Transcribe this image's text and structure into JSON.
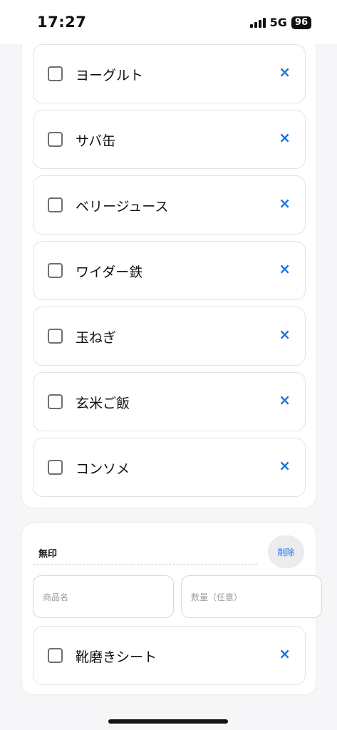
{
  "status": {
    "time": "17:27",
    "network": "5G",
    "battery": "96"
  },
  "list_items": [
    {
      "label": "ヨーグルト",
      "delete_symbol": "×"
    },
    {
      "label": "サバ缶",
      "delete_symbol": "×"
    },
    {
      "label": "ベリージュース",
      "delete_symbol": "×"
    },
    {
      "label": "ワイダー鉄",
      "delete_symbol": "×"
    },
    {
      "label": "玉ねぎ",
      "delete_symbol": "×"
    },
    {
      "label": "玄米ご飯",
      "delete_symbol": "×"
    },
    {
      "label": "コンソメ",
      "delete_symbol": "×"
    }
  ],
  "store": {
    "name": "無印",
    "delete_label": "削除",
    "item_name_placeholder": "商品名",
    "quantity_placeholder": "数量（任意）",
    "items": [
      {
        "label": "靴磨きシート",
        "delete_symbol": "×"
      }
    ]
  },
  "colors": {
    "accent": "#1a73e8"
  }
}
